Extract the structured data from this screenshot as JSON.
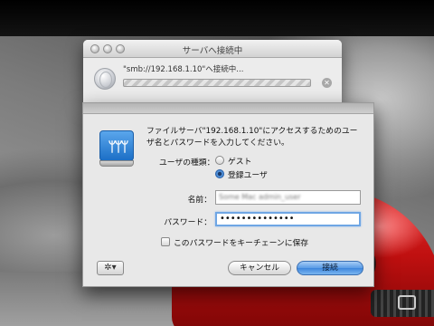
{
  "progress_window": {
    "title": "サーバへ接続中",
    "status": "\"smb://192.168.1.10\"へ接続中...",
    "cancel_glyph": "✕",
    "icon": "globe-icon"
  },
  "login_sheet": {
    "icon": "file-server-icon",
    "message": "ファイルサーバ\"192.168.1.10\"にアクセスするためのユーザ名とパスワードを入力してください。",
    "user_type_label": "ユーザの種類：",
    "radio_guest": "ゲスト",
    "radio_registered": "登録ユーザ",
    "selected_user_type": "登録ユーザ",
    "name_label": "名前：",
    "name_value": "Some Mac admin_user",
    "password_label": "パスワード：",
    "password_value": "••••••••••••••",
    "keychain_label": "このパスワードをキーチェーンに保存",
    "keychain_checked": false,
    "action_glyph": "✲▾",
    "cancel_label": "キャンセル",
    "connect_label": "接続",
    "accent_color": "#3d86dc"
  }
}
